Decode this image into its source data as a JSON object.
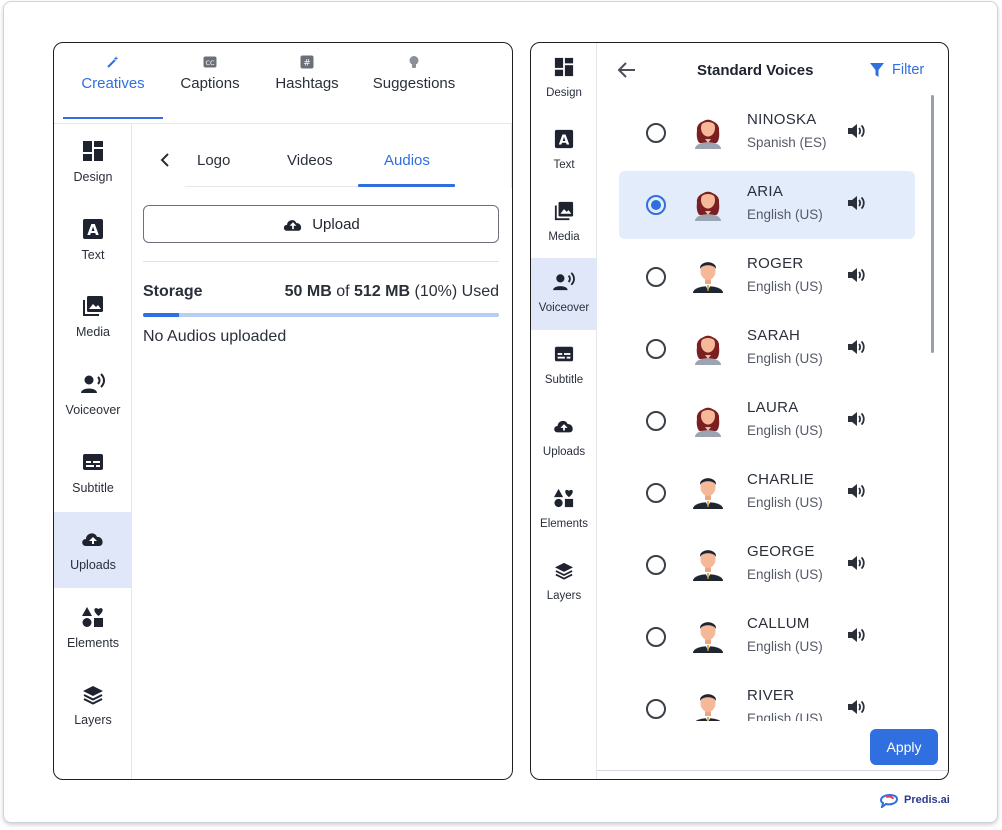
{
  "top_tabs": [
    {
      "label": "Creatives",
      "icon": "wand-icon"
    },
    {
      "label": "Captions",
      "icon": "cc-icon"
    },
    {
      "label": "Hashtags",
      "icon": "hashtag-icon"
    },
    {
      "label": "Suggestions",
      "icon": "bulb-icon"
    }
  ],
  "left_sidebar": [
    {
      "label": "Design"
    },
    {
      "label": "Text"
    },
    {
      "label": "Media"
    },
    {
      "label": "Voiceover"
    },
    {
      "label": "Subtitle"
    },
    {
      "label": "Uploads",
      "active": true
    },
    {
      "label": "Elements"
    },
    {
      "label": "Layers"
    }
  ],
  "sub_tabs": [
    {
      "label": "Logo"
    },
    {
      "label": "Videos"
    },
    {
      "label": "Audios",
      "active": true
    }
  ],
  "upload_button": "Upload",
  "storage": {
    "label": "Storage",
    "used": "50 MB",
    "of": "of",
    "total": "512 MB",
    "percent_text": "(10%) Used",
    "percent": 10
  },
  "empty_message": "No Audios uploaded",
  "right_sidebar": [
    {
      "label": "Design"
    },
    {
      "label": "Text"
    },
    {
      "label": "Media"
    },
    {
      "label": "Voiceover",
      "active": true
    },
    {
      "label": "Subtitle"
    },
    {
      "label": "Uploads"
    },
    {
      "label": "Elements"
    },
    {
      "label": "Layers"
    }
  ],
  "voices_header": {
    "title": "Standard Voices",
    "filter": "Filter"
  },
  "voices": [
    {
      "name": "NINOSKA",
      "lang": "Spanish (ES)",
      "gender": "female",
      "selected": false
    },
    {
      "name": "ARIA",
      "lang": "English (US)",
      "gender": "female",
      "selected": true
    },
    {
      "name": "ROGER",
      "lang": "English (US)",
      "gender": "male",
      "selected": false
    },
    {
      "name": "SARAH",
      "lang": "English (US)",
      "gender": "female",
      "selected": false
    },
    {
      "name": "LAURA",
      "lang": "English (US)",
      "gender": "female",
      "selected": false
    },
    {
      "name": "CHARLIE",
      "lang": "English (US)",
      "gender": "male",
      "selected": false
    },
    {
      "name": "GEORGE",
      "lang": "English (US)",
      "gender": "male",
      "selected": false
    },
    {
      "name": "CALLUM",
      "lang": "English (US)",
      "gender": "male",
      "selected": false
    },
    {
      "name": "RIVER",
      "lang": "English (US)",
      "gender": "male",
      "selected": false
    }
  ],
  "apply_button": "Apply",
  "brand": "Predis.ai",
  "colors": {
    "accent": "#2f6fe0",
    "active_bg": "#dfe7f8",
    "selected_row": "#e3ecfb"
  }
}
